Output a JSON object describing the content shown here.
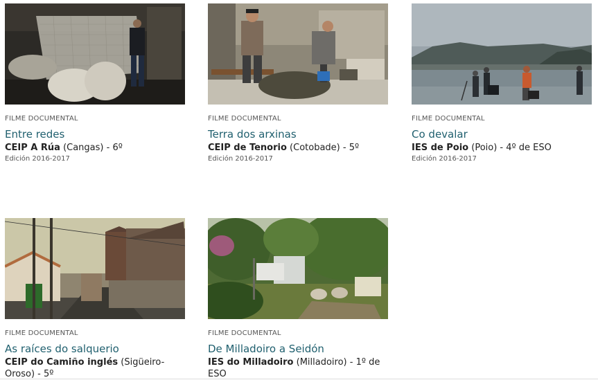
{
  "cards": [
    {
      "category": "FILME DOCUMENTAL",
      "title": "Entre redes",
      "school_name": "CEIP A Rúa",
      "school_rest": " (Cangas) - 6º",
      "edition": "Edición 2016-2017"
    },
    {
      "category": "FILME DOCUMENTAL",
      "title": "Terra dos arxinas",
      "school_name": "CEIP de Tenorio",
      "school_rest": " (Cotobade) - 5º",
      "edition": "Edición 2016-2017"
    },
    {
      "category": "FILME DOCUMENTAL",
      "title": "Co devalar",
      "school_name": "IES de Poio",
      "school_rest": " (Poio) - 4º de ESO",
      "edition": "Edición 2016-2017"
    },
    {
      "category": "FILME DOCUMENTAL",
      "title": "As raíces do salquerio",
      "school_name": "CEIP do Camiño inglés",
      "school_rest": " (Sigüeiro-Oroso) - 5º"
    },
    {
      "category": "FILME DOCUMENTAL",
      "title": "De Milladoiro a Seidón",
      "school_name": "IES do Milladoiro",
      "school_rest": " (Milladoiro) - 1º de ESO"
    }
  ]
}
